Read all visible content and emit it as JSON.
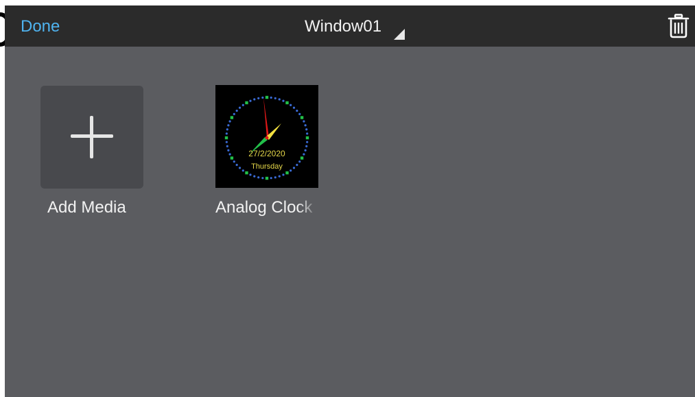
{
  "header": {
    "done_label": "Done",
    "title": "Window01"
  },
  "media": [
    {
      "label": "Add Media",
      "icon": "plus-icon"
    },
    {
      "label": "Analog Clock",
      "icon": "analog-clock-thumbnail",
      "date": "27/2/2020",
      "day": "Thursday"
    }
  ],
  "colors": {
    "accent": "#4fb3ef",
    "background": "#5b5c60",
    "topbar": "#2b2b2b",
    "tile": "#48494d",
    "clock_dial_dots": "#3a6bd6",
    "clock_marks": "#22c04a",
    "clock_text": "#e6d84a"
  }
}
